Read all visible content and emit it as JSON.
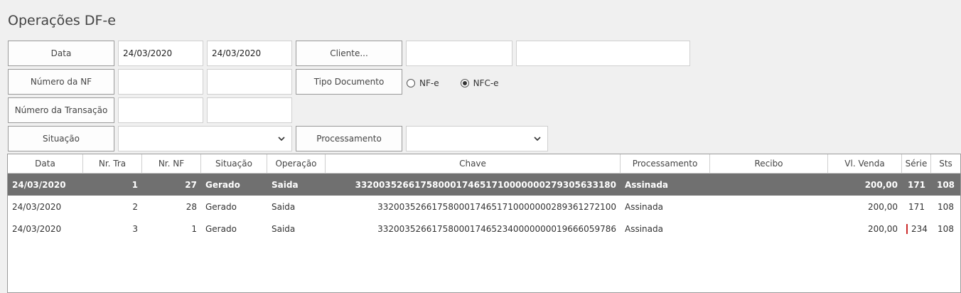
{
  "title": "Operações DF-e",
  "filters": {
    "data_label": "Data",
    "data_from": "24/03/2020",
    "data_to": "24/03/2020",
    "cliente_label": "Cliente...",
    "cliente_code": "",
    "cliente_name": "",
    "numero_nf_label": "Número da NF",
    "numero_nf_from": "",
    "numero_nf_to": "",
    "tipo_documento_label": "Tipo Documento",
    "tipo_options": [
      {
        "label": "NF-e",
        "checked": false
      },
      {
        "label": "NFC-e",
        "checked": true
      }
    ],
    "numero_transacao_label": "Número da Transação",
    "numero_transacao_from": "",
    "numero_transacao_to": "",
    "situacao_label": "Situação",
    "situacao_value": "",
    "processamento_label": "Processamento",
    "processamento_value": ""
  },
  "grid": {
    "columns": [
      "Data",
      "Nr. Tra",
      "Nr. NF",
      "Situação",
      "Operação",
      "Chave",
      "Processamento",
      "Recibo",
      "Vl. Venda",
      "Série",
      "Sts"
    ],
    "rows": [
      [
        "24/03/2020",
        "1",
        "27",
        "Gerado",
        "Saida",
        "33200352661758000174651710000000279305633180",
        "Assinada",
        "",
        "200,00",
        "171",
        "108"
      ],
      [
        "24/03/2020",
        "2",
        "28",
        "Gerado",
        "Saida",
        "33200352661758000174651710000000289361272100",
        "Assinada",
        "",
        "200,00",
        "171",
        "108"
      ],
      [
        "24/03/2020",
        "3",
        "1",
        "Gerado",
        "Saida",
        "33200352661758000174652340000000019666059786",
        "Assinada",
        "",
        "200,00",
        "234",
        "108"
      ]
    ],
    "selected_row": 0,
    "highlighted_cell": {
      "row": 2,
      "column": "Série"
    }
  },
  "colors": {
    "selected_row_bg": "#707070",
    "highlight_border": "#cc2a2a"
  }
}
